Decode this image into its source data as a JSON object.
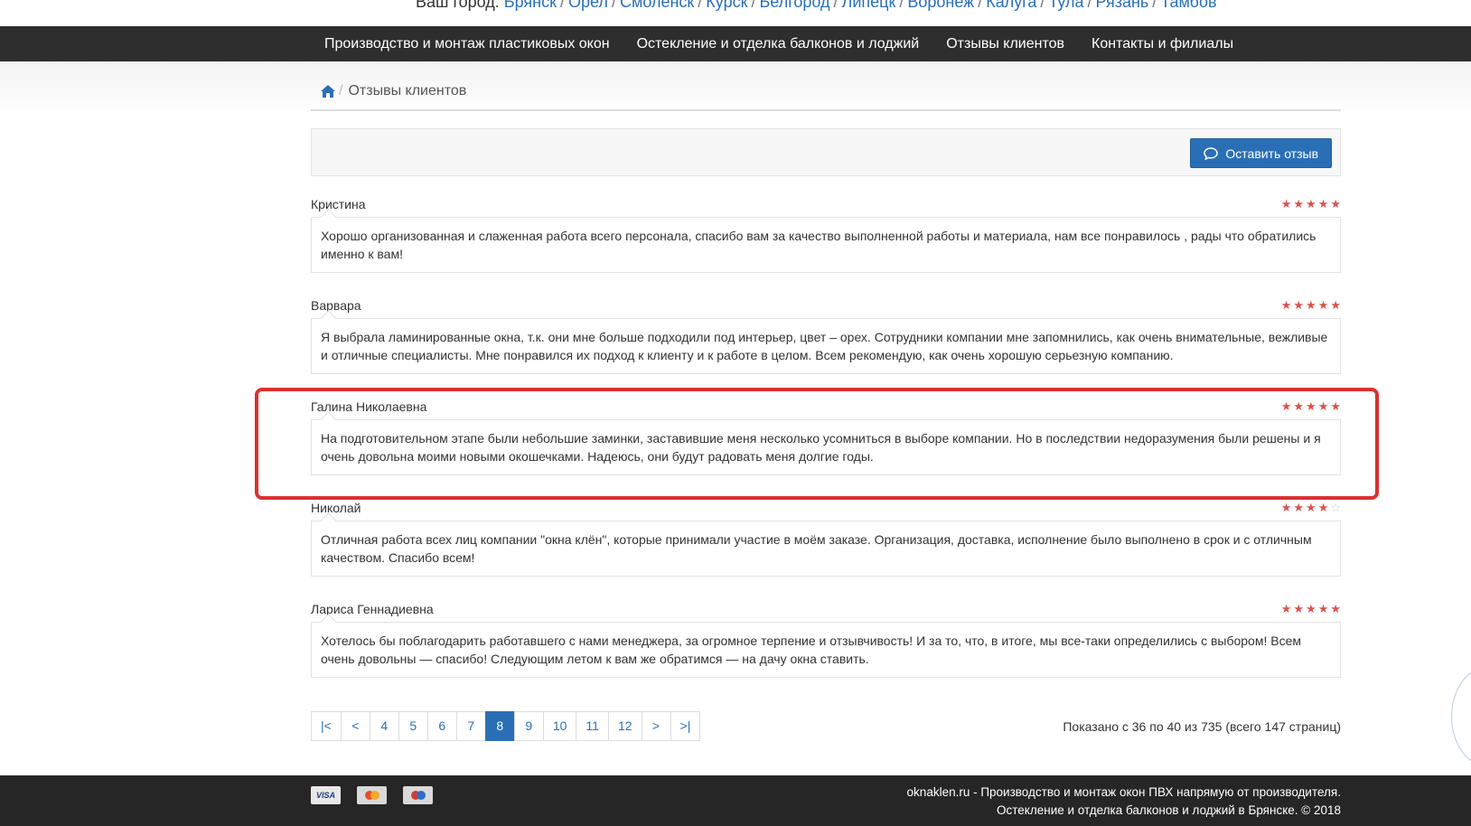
{
  "city_bar": {
    "prefix": "Ваш город:",
    "cities": [
      "Брянск",
      "Орел",
      "Смоленск",
      "Курск",
      "Белгород",
      "Липецк",
      "Воронеж",
      "Калуга",
      "Тула",
      "Рязань",
      "Тамбов"
    ]
  },
  "nav": {
    "items": [
      {
        "label": "Производство и монтаж пластиковых окон"
      },
      {
        "label": "Остекление и отделка балконов и лоджий"
      },
      {
        "label": "Отзывы клиентов"
      },
      {
        "label": "Контакты и филиалы"
      }
    ]
  },
  "breadcrumb": {
    "home_icon": "home-icon",
    "current": "Отзывы клиентов"
  },
  "toolbar": {
    "leave_review_label": "Оставить отзыв",
    "leave_review_icon": "comment-icon"
  },
  "colors": {
    "accent": "#2a6fb6",
    "star": "#d9534f",
    "highlight": "#d9322f",
    "navbar": "#2e2e2e"
  },
  "reviews": [
    {
      "author": "Кристина",
      "rating": 5,
      "text": "Хорошо организованная и слаженная работа всего персонала, спасибо вам за качество выполненной работы и материала, нам все понравилось , рады что обратились именно к вам!"
    },
    {
      "author": "Варвара",
      "rating": 5,
      "text": "Я выбрала ламинированные окна, т.к. они мне больше подходили под интерьер, цвет – орех. Сотрудники компании мне запомнились, как очень внимательные, вежливые и отличные специалисты. Мне понравился их подход к клиенту и к работе в целом. Всем рекомендую, как очень хорошую серьезную компанию."
    },
    {
      "author": "Галина Николаевна",
      "rating": 5,
      "text": "На подготовительном этапе были небольшие заминки, заставившие меня несколько усомниться в выборе компании. Но в последствии недоразумения были решены и я очень довольна моими новыми окошечками. Надеюсь, они будут радовать меня долгие годы."
    },
    {
      "author": "Николай",
      "rating": 4,
      "text": "Отличная работа всех лиц компании \"окна клён\", которые принимали участие в моём заказе. Организация, доставка, исполнение было выполнено в срок и с отличным качеством. Спасибо всем!"
    },
    {
      "author": "Лариса Геннадиевна",
      "rating": 5,
      "text": "Хотелось бы поблагодарить работавшего с нами менеджера, за огромное терпение и отзывчивость! И за то, что, в итоге, мы все-таки определились с выбором! Всем очень довольны — спасибо! Следующим летом к вам же обратимся — на дачу окна ставить."
    }
  ],
  "pagination": {
    "first": "|<",
    "prev": "<",
    "pages": [
      "4",
      "5",
      "6",
      "7",
      "8",
      "9",
      "10",
      "11",
      "12"
    ],
    "active": "8",
    "next": ">",
    "last": ">|",
    "info": "Показано с 36 по 40 из 735 (всего 147 страниц)"
  },
  "footer": {
    "cards": [
      "VISA",
      "MasterCard",
      "Maestro"
    ],
    "line1": "oknaklen.ru - Производство и монтаж окон ПВХ напрямую от производителя.",
    "line2": "Остекление и отделка балконов и лоджий в Брянске. © 2018"
  }
}
